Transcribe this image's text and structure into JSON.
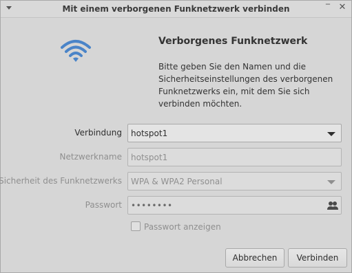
{
  "window": {
    "title": "Mit einem verborgenen Funknetzwerk verbinden",
    "minimize_glyph": "‾",
    "close_glyph": "✕"
  },
  "icons": {
    "main": "wifi-icon",
    "password_toggle": "users-icon"
  },
  "colors": {
    "wifi_blue": "#4a84c8",
    "disabled_text": "#8f8f8f"
  },
  "header": {
    "title": "Verborgenes Funknetzwerk",
    "description": "Bitte geben Sie den Namen und die Sicherheitseinstellungen des verborgenen Funknetzwerks ein, mit dem Sie sich verbinden möchten."
  },
  "form": {
    "connection": {
      "label": "Verbindung",
      "value": "hotspot1"
    },
    "network_name": {
      "label": "Netzwerkname",
      "value": "hotspot1"
    },
    "security": {
      "label": "Sicherheit des Funknetzwerks",
      "value": "WPA & WPA2 Personal"
    },
    "password": {
      "label": "Passwort",
      "value": "••••••••"
    },
    "show_password": {
      "label": "Passwort anzeigen",
      "checked": false
    }
  },
  "buttons": {
    "cancel": "Abbrechen",
    "connect": "Verbinden"
  }
}
